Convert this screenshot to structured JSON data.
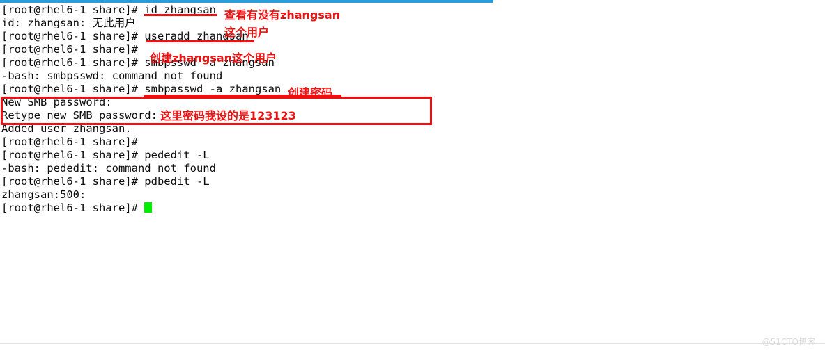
{
  "decorations": {
    "top_rule_color": "#2a9ddb",
    "bottom_rule_color": "#e3e3e3",
    "annotation_color": "#ee1111",
    "cursor_color": "#00ee00",
    "text_color": "#0d0d0d"
  },
  "terminal": {
    "prompt": "[root@rhel6-1 share]#",
    "lines": [
      {
        "id": "line-1",
        "text": "[root@rhel6-1 share]# id zhangsan"
      },
      {
        "id": "line-2",
        "text": "id: zhangsan: 无此用户"
      },
      {
        "id": "line-3",
        "text": "[root@rhel6-1 share]# useradd zhangsan"
      },
      {
        "id": "line-4",
        "text": "[root@rhel6-1 share]#"
      },
      {
        "id": "line-5",
        "text": "[root@rhel6-1 share]# smbpsswd -a zhangsan"
      },
      {
        "id": "line-6",
        "text": "-bash: smbpsswd: command not found"
      },
      {
        "id": "line-7",
        "text": "[root@rhel6-1 share]# smbpasswd -a zhangsan"
      },
      {
        "id": "line-8",
        "text": "New SMB password:"
      },
      {
        "id": "line-9",
        "text": "Retype new SMB password:"
      },
      {
        "id": "line-10",
        "text": "Added user zhangsan."
      },
      {
        "id": "line-11",
        "text": "[root@rhel6-1 share]#"
      },
      {
        "id": "line-12",
        "text": "[root@rhel6-1 share]# pededit -L"
      },
      {
        "id": "line-13",
        "text": "-bash: pededit: command not found"
      },
      {
        "id": "line-14",
        "text": "[root@rhel6-1 share]# pdbedit -L"
      },
      {
        "id": "line-15",
        "text": "zhangsan:500:"
      },
      {
        "id": "line-16",
        "text": "[root@rhel6-1 share]# "
      }
    ]
  },
  "annotations": {
    "check_user_line1": "查看有没有zhangsan",
    "check_user_line2": "这个用户",
    "create_user": "创建zhangsan这个用户",
    "create_password": "创建密码",
    "password_note": "这里密码我设的是123123"
  },
  "watermark": {
    "text": "@51CTO博客"
  }
}
